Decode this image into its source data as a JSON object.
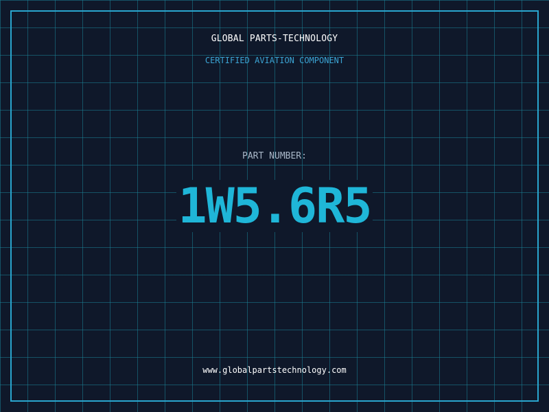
{
  "header": {
    "brand": "GLOBAL PARTS-TECHNOLOGY",
    "subtitle": "CERTIFIED AVIATION COMPONENT"
  },
  "part": {
    "label": "PART NUMBER:",
    "number": "1W5.6R5"
  },
  "footer": {
    "website": "www.globalpartstechnology.com"
  },
  "colors": {
    "background": "#0f182a",
    "grid": "#1a8196",
    "frame": "#2aa6cf",
    "accent": "#1fb6d8",
    "subtitle": "#3ba4d4",
    "label": "#a9b7c8",
    "text": "#ffffff"
  }
}
